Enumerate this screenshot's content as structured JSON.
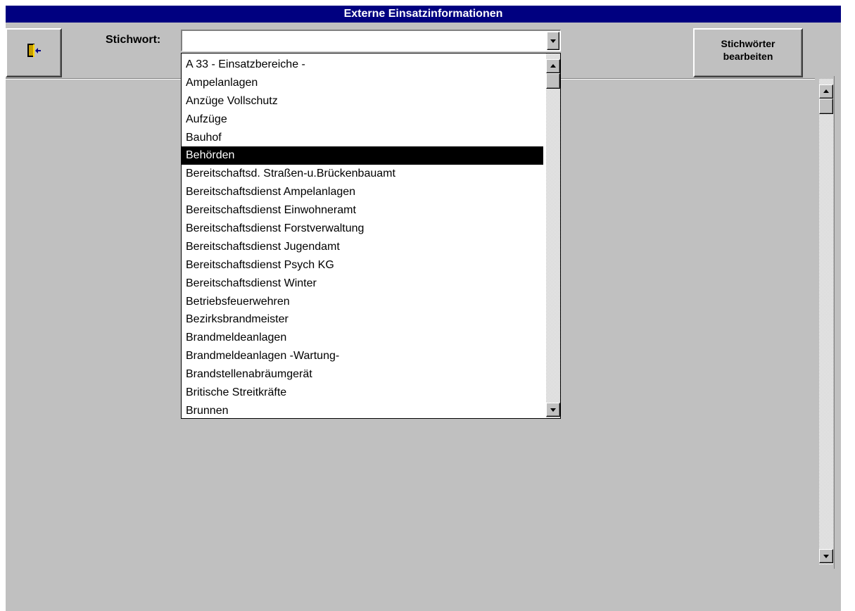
{
  "window": {
    "title": "Externe Einsatzinformationen"
  },
  "toolbar": {
    "exit_icon": "exit-door-icon",
    "keyword_label": "Stichwort:",
    "keyword_value": "",
    "edit_keywords_line1": "Stichwörter",
    "edit_keywords_line2": "bearbeiten"
  },
  "dropdown": {
    "items": [
      "A 33 - Einsatzbereiche -",
      "Ampelanlagen",
      "Anzüge Vollschutz",
      "Aufzüge",
      "Bauhof",
      "Behörden",
      "Bereitschaftsd. Straßen-u.Brückenbauamt",
      "Bereitschaftsdienst Ampelanlagen",
      "Bereitschaftsdienst Einwohneramt",
      "Bereitschaftsdienst Forstverwaltung",
      "Bereitschaftsdienst Jugendamt",
      "Bereitschaftsdienst Psych KG",
      "Bereitschaftsdienst Winter",
      "Betriebsfeuerwehren",
      "Bezirksbrandmeister",
      "Brandmeldeanlagen",
      "Brandmeldeanlagen -Wartung-",
      "Brandstellenabräumgerät",
      "Britische Streitkräfte",
      "Brunnen"
    ],
    "selected_index": 5
  },
  "colors": {
    "title_bar": "#000080",
    "face": "#c0c0c0",
    "selection": "#000000"
  }
}
